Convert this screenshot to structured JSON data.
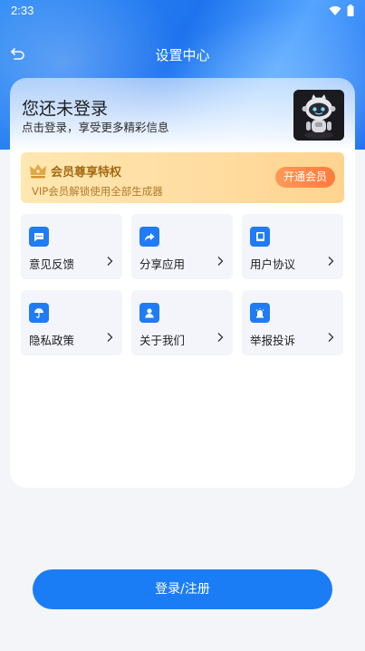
{
  "status_bar": {
    "time": "2:33"
  },
  "header": {
    "title": "设置中心"
  },
  "login": {
    "title": "您还未登录",
    "subtitle": "点击登录，享受更多精彩信息"
  },
  "vip": {
    "title": "会员尊享特权",
    "description": "VIP会员解锁使用全部生成器",
    "button": "开通会员"
  },
  "menu": [
    {
      "label": "意见反馈",
      "icon": "message-icon"
    },
    {
      "label": "分享应用",
      "icon": "share-icon"
    },
    {
      "label": "用户协议",
      "icon": "book-icon"
    },
    {
      "label": "隐私政策",
      "icon": "umbrella-icon"
    },
    {
      "label": "关于我们",
      "icon": "person-icon"
    },
    {
      "label": "举报投诉",
      "icon": "alarm-icon"
    }
  ],
  "login_button": "登录/注册",
  "colors": {
    "primary": "#1a7df5",
    "vip_text": "#a46a12",
    "vip_button": "#ff8a48"
  }
}
